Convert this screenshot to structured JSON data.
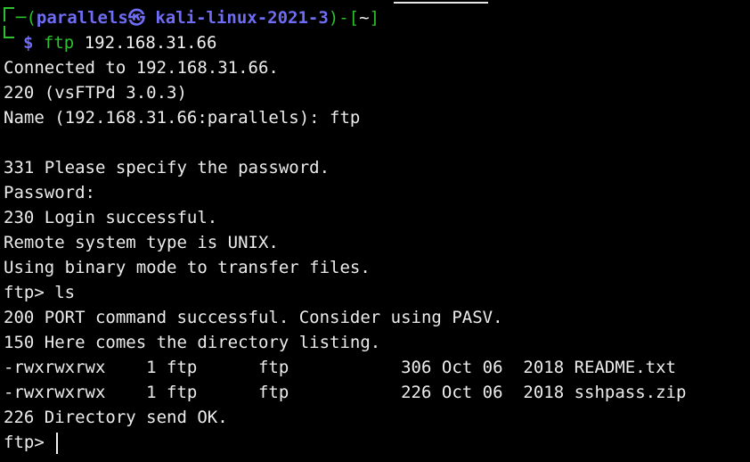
{
  "terminal": {
    "top_clip": "- -- -  -- -- --- -- - - ---- --- -- -- ---  ---- -- ",
    "prompt": {
      "user": "parallels",
      "at": "㉿",
      "host": "kali-linux-2021-3",
      "open": "─(",
      "close": ")-[",
      "dir": "~",
      "dir_close": "]",
      "dollar": "$",
      "command": "ftp",
      "arg": "192.168.31.66"
    },
    "lines": [
      "Connected to 192.168.31.66.",
      "220 (vsFTPd 3.0.3)",
      "Name (192.168.31.66:parallels): ftp",
      "",
      "331 Please specify the password.",
      "Password:",
      "230 Login successful.",
      "Remote system type is UNIX.",
      "Using binary mode to transfer files.",
      "ftp> ls",
      "200 PORT command successful. Consider using PASV.",
      "150 Here comes the directory listing.",
      "-rwxrwxrwx    1 ftp      ftp           306 Oct 06  2018 README.txt",
      "-rwxrwxrwx    1 ftp      ftp           226 Oct 06  2018 sshpass.zip",
      "226 Directory send OK."
    ],
    "final_prompt": "ftp> ",
    "colors": {
      "background": "#000000",
      "text": "#ececec",
      "user_host": "#6f6cf5",
      "frame": "#2fbf2f"
    }
  }
}
